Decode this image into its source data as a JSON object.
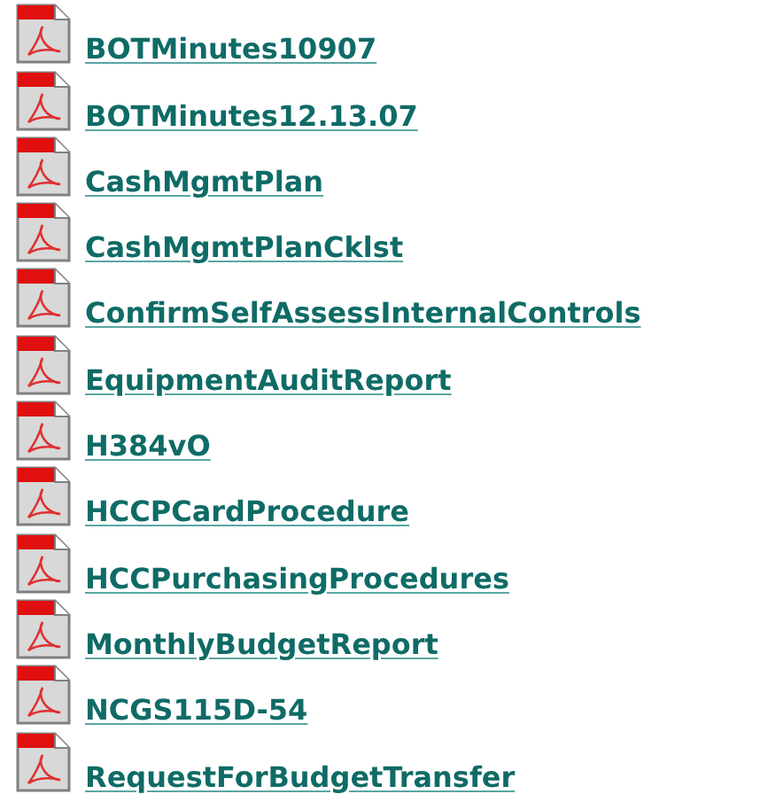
{
  "files": [
    {
      "name": "BOTMinutes10907"
    },
    {
      "name": "BOTMinutes12.13.07"
    },
    {
      "name": "CashMgmtPlan"
    },
    {
      "name": "CashMgmtPlanCklst"
    },
    {
      "name": "ConfirmSelfAssessInternalControls"
    },
    {
      "name": "EquipmentAuditReport"
    },
    {
      "name": "H384vO"
    },
    {
      "name": "HCCPCardProcedure"
    },
    {
      "name": "HCCPurchasingProcedures"
    },
    {
      "name": "MonthlyBudgetReport"
    },
    {
      "name": "NCGS115D-54"
    },
    {
      "name": "RequestForBudgetTransfer"
    }
  ]
}
